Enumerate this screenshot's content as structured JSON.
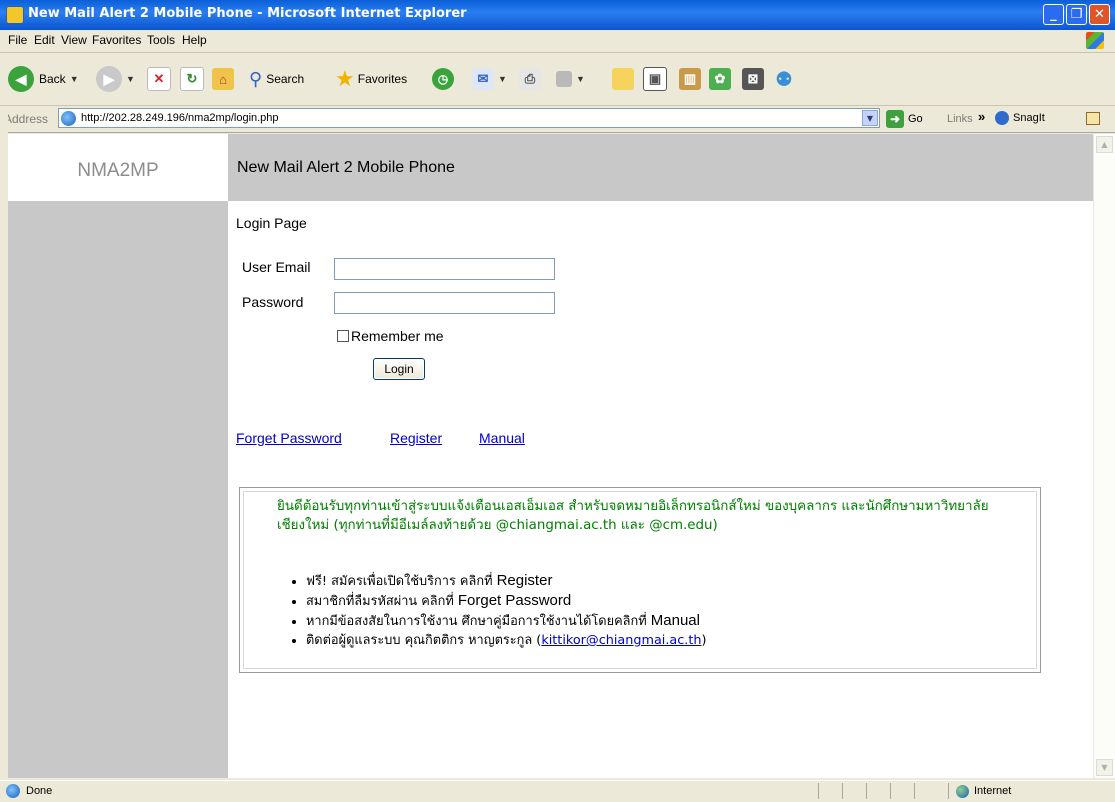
{
  "window": {
    "title": "New Mail Alert 2 Mobile Phone - Microsoft Internet Explorer",
    "buttons": {
      "minimize": "_",
      "maximize": "❐",
      "close": "✕"
    }
  },
  "menu": [
    "File",
    "Edit",
    "View",
    "Favorites",
    "Tools",
    "Help"
  ],
  "toolbar": {
    "back_label": "Back",
    "search_label": "Search",
    "favorites_label": "Favorites"
  },
  "address": {
    "label": "Address",
    "url": "http://202.28.249.196/nma2mp/login.php",
    "go_label": "Go",
    "links_label": "Links",
    "links_chevron": "»",
    "snagit_label": "SnagIt"
  },
  "site": {
    "brand": "NMA2MP",
    "header_title": "New Mail Alert 2 Mobile Phone"
  },
  "login": {
    "heading": "Login Page",
    "email_label": "User Email",
    "email_value": "",
    "password_label": "Password",
    "password_value": "",
    "remember_label": "Remember me",
    "remember_checked": false,
    "submit_label": "Login"
  },
  "links": [
    {
      "label": "Forget Password"
    },
    {
      "label": "Register"
    },
    {
      "label": "Manual"
    }
  ],
  "info": {
    "intro": "ยินดีต้อนรับทุกท่านเข้าสู่ระบบแจ้งเตือนเอสเอ็มเอส สำหรับจดหมายอิเล็กทรอนิกส์ใหม่ ของบุคลากร และนักศึกษามหาวิทยาลัยเชียงใหม่ (ทุกท่านที่มีอีเมล์ลงท้ายด้วย @chiangmai.ac.th และ @cm.edu)",
    "bullets": [
      {
        "text": "ฟรี! สมัครเพื่อเปิดใช้บริการ คลิกที่ ",
        "keyword": "Register"
      },
      {
        "text": "สมาชิกที่ลืมรหัสผ่าน คลิกที่ ",
        "keyword": "Forget Password"
      },
      {
        "text": "หากมีข้อสงสัยในการใช้งาน ศึกษาคู่มือการใช้งานได้โดยคลิกที่ ",
        "keyword": "Manual"
      },
      {
        "text": "ติดต่อผู้ดูแลระบบ คุณกิตติกร หาญตระกูล (",
        "link": "kittikor@chiangmai.ac.th",
        "suffix": ")"
      }
    ]
  },
  "status": {
    "text": "Done",
    "zone": "Internet"
  },
  "colors": {
    "title_bar": "#0a5fd8",
    "sidebar_gray": "#c8c8c8",
    "intro_green": "#008000",
    "link_blue": "#0000cc"
  }
}
